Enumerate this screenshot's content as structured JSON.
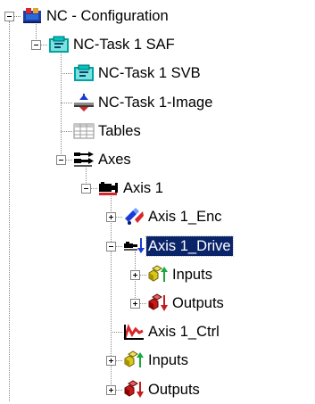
{
  "tree": {
    "nodes": [
      {
        "id": "nc-configuration",
        "label": "NC - Configuration",
        "level": 0,
        "icon": "nc-configuration-icon",
        "expander": "minus"
      },
      {
        "id": "nc-task-1-saf",
        "label": "NC-Task 1 SAF",
        "level": 1,
        "icon": "task-icon",
        "expander": "minus"
      },
      {
        "id": "nc-task-1-svb",
        "label": "NC-Task 1 SVB",
        "level": 2,
        "icon": "task-icon",
        "expander": null
      },
      {
        "id": "nc-task-1-image",
        "label": "NC-Task 1-Image",
        "level": 2,
        "icon": "image-icon",
        "expander": null
      },
      {
        "id": "tables",
        "label": "Tables",
        "level": 2,
        "icon": "table-icon",
        "expander": null
      },
      {
        "id": "axes",
        "label": "Axes",
        "level": 2,
        "icon": "axes-icon",
        "expander": "minus"
      },
      {
        "id": "axis-1",
        "label": "Axis 1",
        "level": 3,
        "icon": "axis-icon",
        "expander": "minus"
      },
      {
        "id": "axis-1-enc",
        "label": "Axis 1_Enc",
        "level": 4,
        "icon": "encoder-icon",
        "expander": "plus"
      },
      {
        "id": "axis-1-drive",
        "label": "Axis 1_Drive",
        "level": 4,
        "icon": "drive-icon",
        "expander": "minus",
        "selected": true
      },
      {
        "id": "drive-inputs",
        "label": "Inputs",
        "level": 5,
        "icon": "inputs-icon",
        "expander": "plus"
      },
      {
        "id": "drive-outputs",
        "label": "Outputs",
        "level": 5,
        "icon": "outputs-icon",
        "expander": "plus"
      },
      {
        "id": "axis-1-ctrl",
        "label": "Axis 1_Ctrl",
        "level": 4,
        "icon": "controller-icon",
        "expander": null
      },
      {
        "id": "axis-1-inputs",
        "label": "Inputs",
        "level": 4,
        "icon": "inputs-icon",
        "expander": "plus"
      },
      {
        "id": "axis-1-outputs",
        "label": "Outputs",
        "level": 4,
        "icon": "outputs-icon",
        "expander": "plus"
      }
    ]
  },
  "colors": {
    "selection_bg": "#0a246a",
    "selection_text": "#ffffff",
    "tree_lines": "#8a8a8a"
  }
}
